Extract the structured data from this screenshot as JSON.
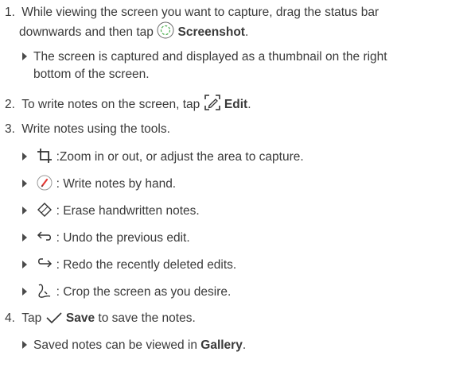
{
  "steps": {
    "s1_num": "1.",
    "s1_line1": "While viewing the screen you want to capture, drag the status bar",
    "s1_line2a": "downwards and then tap",
    "s1_bold": "Screenshot",
    "s1_line2b": ".",
    "s1_b1_line1": "The screen is captured and displayed as a thumbnail on the right",
    "s1_b1_line2": "bottom of the screen.",
    "s2_num": "2.",
    "s2_text": "To write notes on the screen, tap",
    "s2_bold": "Edit",
    "s2_end": ".",
    "s3_num": "3.",
    "s3_text": "Write notes using the tools.",
    "tools": [
      {
        "icon": "crop-icon",
        "text": ":Zoom in or out, or adjust the area to capture."
      },
      {
        "icon": "pen-icon",
        "text": ": Write notes by hand."
      },
      {
        "icon": "eraser-icon",
        "text": ": Erase handwritten notes."
      },
      {
        "icon": "undo-icon",
        "text": ": Undo the previous edit."
      },
      {
        "icon": "redo-icon",
        "text": ": Redo the recently deleted edits."
      },
      {
        "icon": "lasso-crop-icon",
        "text": ": Crop the screen as you desire."
      }
    ],
    "s4_num": "4.",
    "s4_text_a": "Tap",
    "s4_bold": "Save",
    "s4_text_b": "to save the notes.",
    "s4_b1_a": "Saved notes can be viewed in",
    "s4_b1_bold": "Gallery",
    "s4_b1_end": "."
  }
}
